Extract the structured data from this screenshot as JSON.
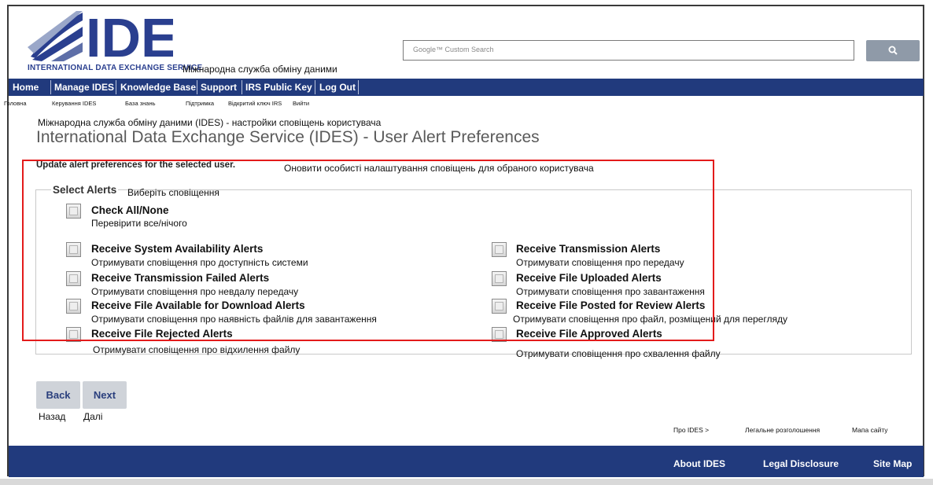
{
  "header": {
    "logo_text": "IDES",
    "logo_subtitle": "INTERNATIONAL DATA EXCHANGE SERVICE",
    "logo_translation": "Міжнародна служба обміну даними",
    "search_placeholder": "Google™ Custom Search"
  },
  "nav": {
    "items": [
      {
        "label": "Home",
        "ua": "Головна"
      },
      {
        "label": "Manage IDES",
        "ua": "Керування IDES"
      },
      {
        "label": "Knowledge Base",
        "ua": "База знань"
      },
      {
        "label": "Support",
        "ua": "Підтримка"
      },
      {
        "label": "IRS Public Key",
        "ua": "Відкритий ключ IRS"
      },
      {
        "label": "Log Out",
        "ua": "Вийти"
      }
    ]
  },
  "page": {
    "title_ua": "Міжнародна служба обміну даними (IDES) - настройки сповіщень користувача",
    "title": "International Data Exchange Service (IDES) - User Alert Preferences",
    "subtitle": "Update alert preferences for the selected user.",
    "subtitle_ua": "Оновити особисті налаштування сповіщень для обраного користувача"
  },
  "alerts": {
    "legend": "Select Alerts",
    "legend_ua": "Виберіть сповіщення",
    "check_all": {
      "label": "Check All/None",
      "ua": "Перевірити все/нічого"
    },
    "left": [
      {
        "label": "Receive System Availability Alerts",
        "ua": "Отримувати сповіщення про доступність системи"
      },
      {
        "label": "Receive Transmission Failed Alerts",
        "ua": "Отримувати сповіщення про невдалу передачу"
      },
      {
        "label": "Receive File Available for Download Alerts",
        "ua": "Отримувати сповіщення про наявність файлів для завантаження"
      },
      {
        "label": "Receive File Rejected Alerts",
        "ua": "Отримувати сповіщення про відхилення файлу"
      }
    ],
    "right": [
      {
        "label": "Receive Transmission Alerts",
        "ua": "Отримувати сповіщення про передачу"
      },
      {
        "label": "Receive File Uploaded Alerts",
        "ua": "Отримувати сповіщення про завантаження"
      },
      {
        "label": "Receive File Posted for Review Alerts",
        "ua": "Отримувати сповіщення про файл, розміщений для перегляду"
      },
      {
        "label": "Receive File Approved Alerts",
        "ua": "Отримувати сповіщення про схвалення файлу"
      }
    ]
  },
  "buttons": {
    "back": "Back",
    "back_ua": "Назад",
    "next": "Next",
    "next_ua": "Далі"
  },
  "footer": {
    "about": "About IDES",
    "about_ua": "Про IDES  >",
    "legal": "Legal Disclosure",
    "legal_ua": "Легальне розголошення",
    "sitemap": "Site Map",
    "sitemap_ua": "Мапа сайту"
  },
  "colors": {
    "nav_bg": "#213a7d",
    "highlight": "#e31b1b",
    "button_bg": "#cfd3d9"
  }
}
